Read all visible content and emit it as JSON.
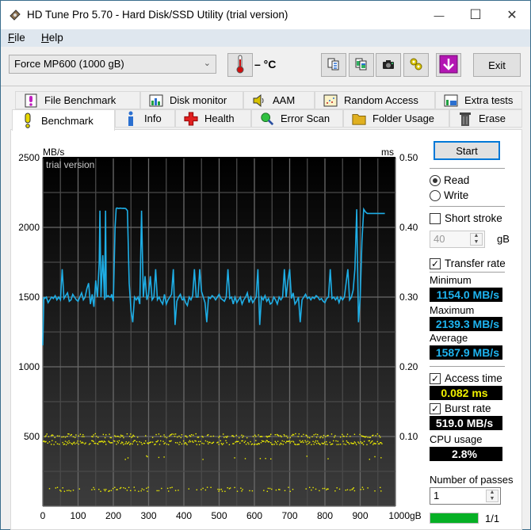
{
  "window": {
    "title": "HD Tune Pro 5.70 - Hard Disk/SSD Utility (trial version)",
    "controls": {
      "minimize": "—",
      "maximize": "☐",
      "close": "✕"
    }
  },
  "menu": {
    "items": [
      {
        "label": "File",
        "accel": "F"
      },
      {
        "label": "Help",
        "accel": "H"
      }
    ]
  },
  "toolbar": {
    "drive": "Force MP600 (1000 gB)",
    "temperature": "– °C",
    "buttons": [
      "copy-text-icon",
      "copy-screenshot-icon",
      "camera-icon",
      "options-icon",
      "save-download-icon"
    ],
    "exit_label": "Exit",
    "download_color": "#b316b3"
  },
  "tabs": {
    "row1": [
      {
        "label": "File Benchmark",
        "icon": "file-benchmark-icon"
      },
      {
        "label": "Disk monitor",
        "icon": "disk-monitor-icon"
      },
      {
        "label": "AAM",
        "icon": "speaker-icon"
      },
      {
        "label": "Random Access",
        "icon": "random-access-icon"
      },
      {
        "label": "Extra tests",
        "icon": "extra-tests-icon"
      }
    ],
    "row2": [
      {
        "label": "Benchmark",
        "icon": "exclamation-icon",
        "active": true
      },
      {
        "label": "Info",
        "icon": "info-icon"
      },
      {
        "label": "Health",
        "icon": "health-cross-icon"
      },
      {
        "label": "Error Scan",
        "icon": "magnifier-icon"
      },
      {
        "label": "Folder Usage",
        "icon": "folder-icon"
      },
      {
        "label": "Erase",
        "icon": "trash-icon"
      }
    ]
  },
  "side": {
    "start_label": "Start",
    "read_label": "Read",
    "write_label": "Write",
    "mode": "read",
    "short_stroke_label": "Short stroke",
    "short_stroke_checked": false,
    "short_stroke_value": "40",
    "short_stroke_unit": "gB",
    "transfer_rate_label": "Transfer rate",
    "transfer_rate_checked": true,
    "minimum_label": "Minimum",
    "minimum_value": "1154.0 MB/s",
    "maximum_label": "Maximum",
    "maximum_value": "2139.3 MB/s",
    "average_label": "Average",
    "average_value": "1587.9 MB/s",
    "access_time_label": "Access time",
    "access_time_checked": true,
    "access_time_value": "0.082 ms",
    "burst_rate_label": "Burst rate",
    "burst_rate_checked": true,
    "burst_rate_value": "519.0 MB/s",
    "cpu_label": "CPU usage",
    "cpu_value": "2.8%",
    "passes_label": "Number of passes",
    "passes_value": "1",
    "progress_fraction": 1.0,
    "progress_label": "1/1"
  },
  "chart_data": {
    "type": "line",
    "title": "",
    "watermark": "trial version",
    "ylabel": "MB/s",
    "y2label": "ms",
    "xlabel": "gB",
    "xlim": [
      0,
      1000
    ],
    "ylim": [
      0,
      2500
    ],
    "y2lim": [
      0,
      0.5
    ],
    "x_ticks": [
      "0",
      "100",
      "200",
      "300",
      "400",
      "500",
      "600",
      "700",
      "800",
      "900",
      "1000gB"
    ],
    "y_ticks": [
      "2500",
      "2000",
      "1500",
      "1000",
      "500"
    ],
    "y2_ticks": [
      "0.50",
      "0.40",
      "0.30",
      "0.20",
      "0.10"
    ],
    "grid": true,
    "series": [
      {
        "name": "Transfer rate (MB/s)",
        "color": "#1eaee6",
        "x": [
          0,
          3,
          5,
          10,
          15,
          20,
          25,
          30,
          35,
          40,
          45,
          50,
          55,
          60,
          65,
          70,
          75,
          80,
          85,
          90,
          95,
          100,
          105,
          110,
          115,
          120,
          125,
          130,
          135,
          140,
          145,
          150,
          155,
          160,
          162,
          165,
          170,
          175,
          178,
          180,
          185,
          190,
          193,
          195,
          200,
          205,
          208,
          210,
          215,
          220,
          225,
          230,
          235,
          240,
          245,
          250,
          255,
          260,
          265,
          270,
          275,
          280,
          285,
          290,
          295,
          300,
          305,
          310,
          315,
          320,
          325,
          330,
          335,
          340,
          345,
          350,
          355,
          360,
          365,
          370,
          375,
          380,
          385,
          390,
          395,
          398,
          400,
          405,
          410,
          415,
          420,
          425,
          430,
          435,
          440,
          445,
          450,
          455,
          460,
          465,
          470,
          475,
          480,
          485,
          490,
          495,
          500,
          505,
          510,
          515,
          520,
          525,
          530,
          535,
          540,
          545,
          550,
          555,
          560,
          565,
          570,
          575,
          580,
          585,
          590,
          595,
          600,
          605,
          610,
          615,
          620,
          625,
          630,
          635,
          640,
          645,
          650,
          655,
          660,
          665,
          670,
          675,
          680,
          685,
          690,
          695,
          700,
          705,
          710,
          715,
          720,
          725,
          730,
          735,
          740,
          745,
          750,
          755,
          760,
          765,
          770,
          775,
          780,
          785,
          790,
          795,
          800,
          805,
          810,
          815,
          820,
          825,
          830,
          835,
          840,
          845,
          850,
          855,
          860,
          865,
          870,
          875,
          880,
          885,
          890,
          895,
          900,
          905,
          910,
          915,
          920,
          925,
          930,
          935,
          940,
          942,
          945,
          948,
          950,
          953,
          955,
          960,
          965,
          970,
          975,
          980,
          985,
          990,
          995,
          1000
        ],
        "y": [
          1154,
          1500,
          1490,
          1500,
          1460,
          1480,
          1500,
          1490,
          1510,
          1480,
          1500,
          1480,
          1700,
          1490,
          1510,
          1530,
          1470,
          1480,
          1520,
          1500,
          1480,
          1470,
          1500,
          1530,
          1480,
          1500,
          1560,
          1600,
          1450,
          1520,
          1430,
          1620,
          1500,
          1750,
          2120,
          1500,
          1800,
          1480,
          2120,
          1500,
          1510,
          1500,
          1500,
          1520,
          1470,
          2000,
          2135,
          2139,
          2135,
          2138,
          2136,
          2137,
          2135,
          2120,
          1600,
          1400,
          1320,
          1500,
          1480,
          1500,
          1450,
          2120,
          1500,
          1650,
          1480,
          1520,
          1650,
          1480,
          1500,
          1700,
          1480,
          1500,
          1470,
          1450,
          1520,
          1450,
          1480,
          1500,
          1520,
          1700,
          1300,
          1470,
          1500,
          1520,
          1480,
          1480,
          1500,
          1460,
          1440,
          1500,
          1480,
          1510,
          1700,
          1500,
          1500,
          1700,
          1540,
          1500,
          1460,
          1320,
          1500,
          1490,
          1510,
          1500,
          1480,
          1500,
          1520,
          1490,
          1480,
          1470,
          1500,
          1700,
          1490,
          1500,
          1450,
          1500,
          1460,
          1480,
          1500,
          1450,
          1480,
          1500,
          1530,
          1460,
          1500,
          1460,
          1480,
          1500,
          1700,
          1300,
          1500,
          1480,
          1510,
          1470,
          1490,
          1450,
          1460,
          1500,
          1480,
          1450,
          1500,
          1480,
          1500,
          1700,
          1500,
          1620,
          1700,
          1490,
          1530,
          1450,
          1470,
          1500,
          1320,
          1480,
          1500,
          1520,
          1490,
          1500,
          1480,
          1500,
          1490,
          1510,
          1500,
          1480,
          1490,
          1470,
          1460,
          1490,
          1500,
          1700,
          1490,
          1500,
          1480,
          1500,
          1460,
          1500,
          1480,
          1500,
          1600,
          1700,
          1480,
          1500,
          1550,
          1700,
          2130,
          1320,
          1500,
          1900,
          2130,
          2110,
          2100,
          2100,
          2100,
          2100,
          2100,
          2100,
          2100,
          2100,
          2100,
          2100,
          2100,
          2100,
          2100,
          2100
        ]
      },
      {
        "name": "Access time (ms)",
        "color": "#f0f000",
        "type": "scatter",
        "bands_ms": [
          0.102,
          0.092,
          0.07,
          0.025
        ],
        "band_density": [
          0.45,
          0.75,
          0.04,
          0.3
        ],
        "x_range": [
          0,
          1000
        ]
      }
    ]
  }
}
